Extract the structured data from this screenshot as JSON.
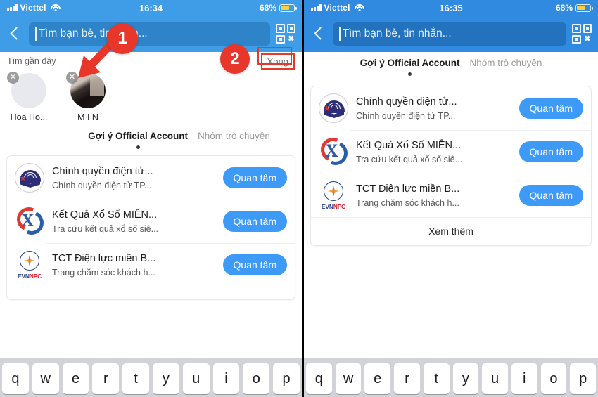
{
  "meta": {
    "accent_blue": "#3d9bf7",
    "header_blue_left": "#3f9de8",
    "header_blue_right": "#2f8ae0",
    "annotation_red": "#e8362a",
    "battery_yellow": "#f6d242"
  },
  "left": {
    "status": {
      "carrier": "Viettel",
      "time": "16:34",
      "battery": "68%",
      "signal_icon": "signal-bars-icon",
      "wifi_icon": "wifi-icon",
      "battery_icon": "battery-icon"
    },
    "search": {
      "back_icon": "back-chevron-icon",
      "placeholder": "Tìm bạn bè, tin nhắn...",
      "qr_icon": "qr-code-icon"
    },
    "recent": {
      "label": "Tìm gần đây",
      "done_label": "Xong",
      "close_glyph": "✕",
      "items": [
        {
          "name": "Hoa Ho...",
          "avatar": "placeholder-avatar"
        },
        {
          "name": "M I N",
          "avatar": "photo-avatar"
        }
      ]
    },
    "tabs": [
      {
        "label": "Gợi ý Official Account",
        "active": true
      },
      {
        "label": "Nhóm trò chuyện",
        "active": false
      }
    ],
    "oa_list": [
      {
        "title": "Chính quyền điện tử...",
        "subtitle": "Chính quyền điện tử TP...",
        "button": "Quan tâm",
        "logo": "government-portal-logo"
      },
      {
        "title": "Kết Quả Xổ Số MIỀN...",
        "subtitle": "Tra cứu kết quả xổ số siê...",
        "button": "Quan tâm",
        "logo": "lottery-results-logo"
      },
      {
        "title": "TCT Điện lực miền B...",
        "subtitle": "Trang chăm sóc khách h...",
        "button": "Quan tâm",
        "logo": "evn-npc-logo"
      }
    ],
    "annotations": [
      {
        "label": "1",
        "kind": "step-marker-arrow"
      },
      {
        "label": "2",
        "kind": "step-marker-box"
      }
    ],
    "keyboard": {
      "row": [
        "q",
        "w",
        "e",
        "r",
        "t",
        "y",
        "u",
        "i",
        "o",
        "p"
      ]
    }
  },
  "right": {
    "status": {
      "carrier": "Viettel",
      "time": "16:35",
      "battery": "68%",
      "signal_icon": "signal-bars-icon",
      "wifi_icon": "wifi-icon",
      "battery_icon": "battery-icon"
    },
    "search": {
      "back_icon": "back-chevron-icon",
      "placeholder": "Tìm bạn bè, tin nhắn...",
      "qr_icon": "qr-code-icon"
    },
    "tabs": [
      {
        "label": "Gợi ý Official Account",
        "active": true
      },
      {
        "label": "Nhóm trò chuyện",
        "active": false
      }
    ],
    "oa_list": [
      {
        "title": "Chính quyền điện tử...",
        "subtitle": "Chính quyền điện tử TP...",
        "button": "Quan tâm",
        "logo": "government-portal-logo"
      },
      {
        "title": "Kết Quả Xổ Số MIỀN...",
        "subtitle": "Tra cứu kết quả xổ số siê...",
        "button": "Quan tâm",
        "logo": "lottery-results-logo"
      },
      {
        "title": "TCT Điện lực miền B...",
        "subtitle": "Trang chăm sóc khách h...",
        "button": "Quan tâm",
        "logo": "evn-npc-logo"
      }
    ],
    "see_more": "Xem thêm",
    "keyboard": {
      "row": [
        "q",
        "w",
        "e",
        "r",
        "t",
        "y",
        "u",
        "i",
        "o",
        "p"
      ]
    }
  }
}
